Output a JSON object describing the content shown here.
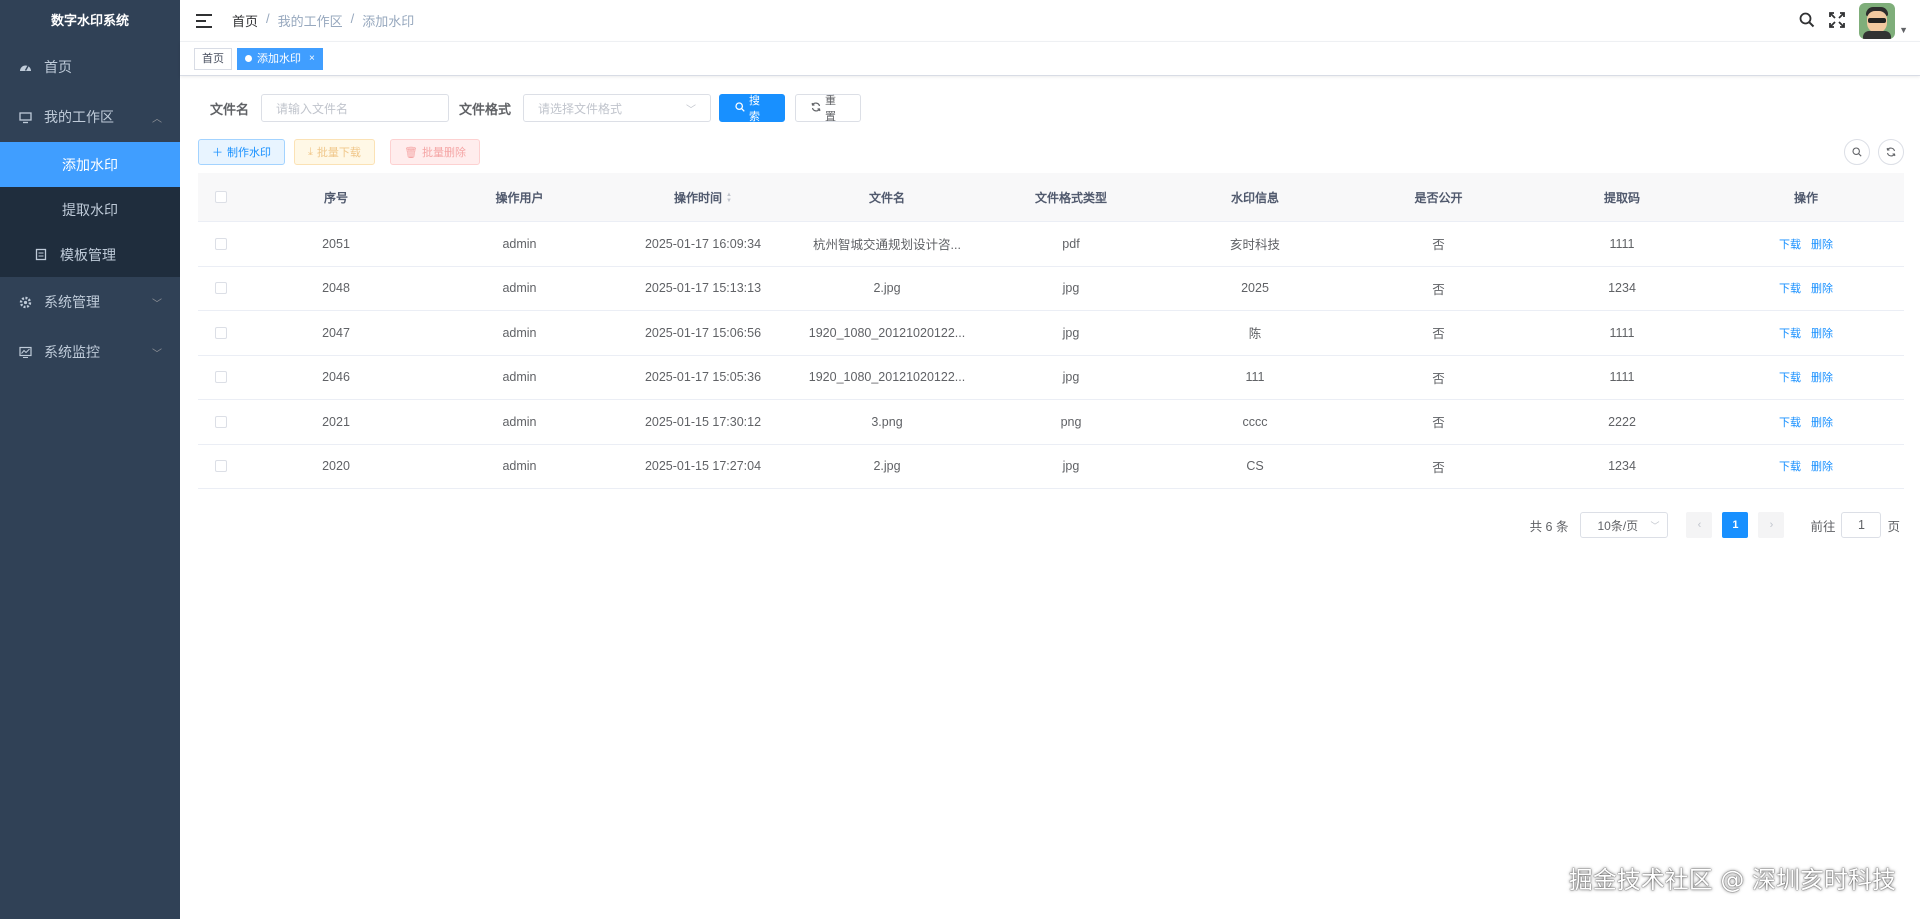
{
  "sidebar": {
    "logo": "数字水印系统",
    "items": [
      {
        "label": "首页"
      },
      {
        "label": "我的工作区"
      },
      {
        "label": "添加水印"
      },
      {
        "label": "提取水印"
      },
      {
        "label": "模板管理"
      },
      {
        "label": "系统管理"
      },
      {
        "label": "系统监控"
      }
    ]
  },
  "header": {
    "breadcrumb": [
      "首页",
      "/",
      "我的工作区",
      "/",
      "添加水印"
    ]
  },
  "tags": {
    "home": "首页",
    "active": "添加水印",
    "close": "×"
  },
  "search": {
    "filename_label": "文件名",
    "filename_placeholder": "请输入文件名",
    "format_label": "文件格式",
    "format_placeholder": "请选择文件格式",
    "search_button": "搜索",
    "reset_button": "重置"
  },
  "toolbar": {
    "make": "制作水印",
    "batch_download": "批量下载",
    "batch_delete": "批量删除"
  },
  "table": {
    "columns": [
      "序号",
      "操作用户",
      "操作时间",
      "文件名",
      "文件格式类型",
      "水印信息",
      "是否公开",
      "提取码",
      "操作"
    ],
    "rows": [
      [
        "2051",
        "admin",
        "2025-01-17 16:09:34",
        "杭州智城交通规划设计咨...",
        "pdf",
        "亥时科技",
        "否",
        "1111"
      ],
      [
        "2048",
        "admin",
        "2025-01-17 15:13:13",
        "2.jpg",
        "jpg",
        "2025",
        "否",
        "1234"
      ],
      [
        "2047",
        "admin",
        "2025-01-17 15:06:56",
        "1920_1080_20121020122...",
        "jpg",
        "陈",
        "否",
        "1111"
      ],
      [
        "2046",
        "admin",
        "2025-01-17 15:05:36",
        "1920_1080_20121020122...",
        "jpg",
        "111",
        "否",
        "1111"
      ],
      [
        "2021",
        "admin",
        "2025-01-15 17:30:12",
        "3.png",
        "png",
        "cccc",
        "否",
        "2222"
      ],
      [
        "2020",
        "admin",
        "2025-01-15 17:27:04",
        "2.jpg",
        "jpg",
        "CS",
        "否",
        "1234"
      ]
    ],
    "op_download": "下载",
    "op_delete": "删除"
  },
  "pagination": {
    "total": "共 6 条",
    "page_size": "10条/页",
    "current": "1",
    "goto_label": "前往",
    "goto_value": "1",
    "page_suffix": "页"
  },
  "watermark": "掘金技术社区 @ 深圳亥时科技",
  "colors": {
    "sidebar": "#304156",
    "accent": "#1890ff",
    "submenu": "#1f2d3d"
  }
}
